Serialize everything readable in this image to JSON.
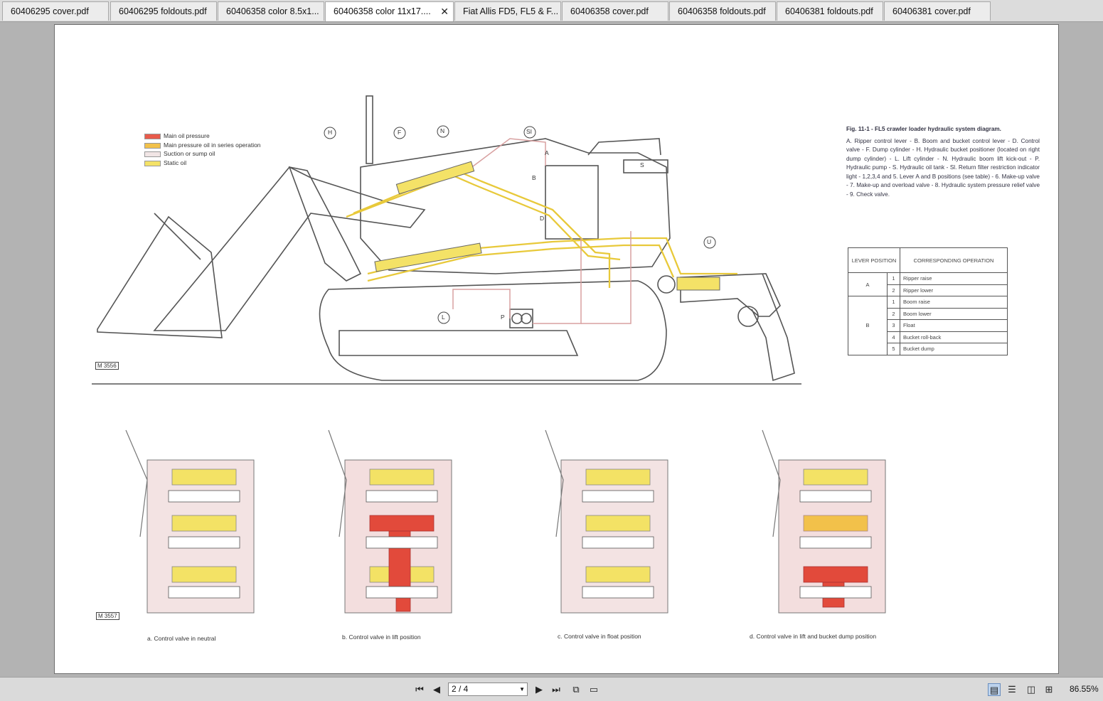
{
  "tabs": [
    {
      "label": "60406295 cover.pdf",
      "active": false
    },
    {
      "label": "60406295 foldouts.pdf",
      "active": false
    },
    {
      "label": "60406358 color 8.5x1...",
      "active": false
    },
    {
      "label": "60406358 color 11x17....",
      "active": true
    },
    {
      "label": "Fiat Allis FD5, FL5 & F...",
      "active": false
    },
    {
      "label": "60406358 cover.pdf",
      "active": false
    },
    {
      "label": "60406358 foldouts.pdf",
      "active": false
    },
    {
      "label": "60406381 foldouts.pdf",
      "active": false
    },
    {
      "label": "60406381 cover.pdf",
      "active": false
    }
  ],
  "legend": {
    "items": [
      {
        "label": "Main oil pressure",
        "color": "#e85b4b"
      },
      {
        "label": "Main pressure oil in series operation",
        "color": "#f2c14a"
      },
      {
        "label": "Suction or sump oil",
        "color": "#f1e5e5"
      },
      {
        "label": "Static oil",
        "color": "#f4e267"
      }
    ]
  },
  "figure": {
    "title": "Fig. 11-1 - FL5 crawler loader hydraulic system diagram.",
    "caption": "A. Ripper control lever - B. Boom and bucket control lever - D. Control valve - F. Dump cylinder - H. Hydraulic bucket positioner (located on right dump cylinder) - L. Lift cylinder - N. Hydraulic boom lift kick-out - P. Hydraulic pump - S. Hydraulic oil tank - Sl. Return filter restriction indicator light - 1,2,3,4 and 5. Lever A and B positions (see table) - 6. Make-up valve - 7. Make-up and overload valve - 8. Hydraulic system pressure relief valve - 9. Check valve.",
    "code_top": "M 3556",
    "code_bottom": "M 3557"
  },
  "lever_table": {
    "header_position": "LEVER POSITION",
    "header_operation": "CORRESPONDING OPERATION",
    "rows": [
      {
        "lever": "A",
        "num": "1",
        "op": "Ripper raise"
      },
      {
        "lever": "",
        "num": "2",
        "op": "Ripper lower"
      },
      {
        "lever": "",
        "num": "1",
        "op": "Boom raise"
      },
      {
        "lever": "",
        "num": "2",
        "op": "Boom lower"
      },
      {
        "lever": "B",
        "num": "3",
        "op": "Float"
      },
      {
        "lever": "",
        "num": "4",
        "op": "Bucket roll-back"
      },
      {
        "lever": "",
        "num": "5",
        "op": "Bucket dump"
      }
    ]
  },
  "callouts": {
    "H": "H",
    "F": "F",
    "N": "N",
    "SI": "SI",
    "A": "A",
    "B": "B",
    "D": "D",
    "S": "S",
    "U": "U",
    "L": "L",
    "P": "P"
  },
  "valve_captions": [
    "a. Control valve in neutral",
    "b. Control valve in lift position",
    "c. Control valve in float position",
    "d. Control valve in lift and bucket dump position"
  ],
  "toolbar": {
    "page_value": "2 / 4",
    "zoom": "86.55%"
  }
}
